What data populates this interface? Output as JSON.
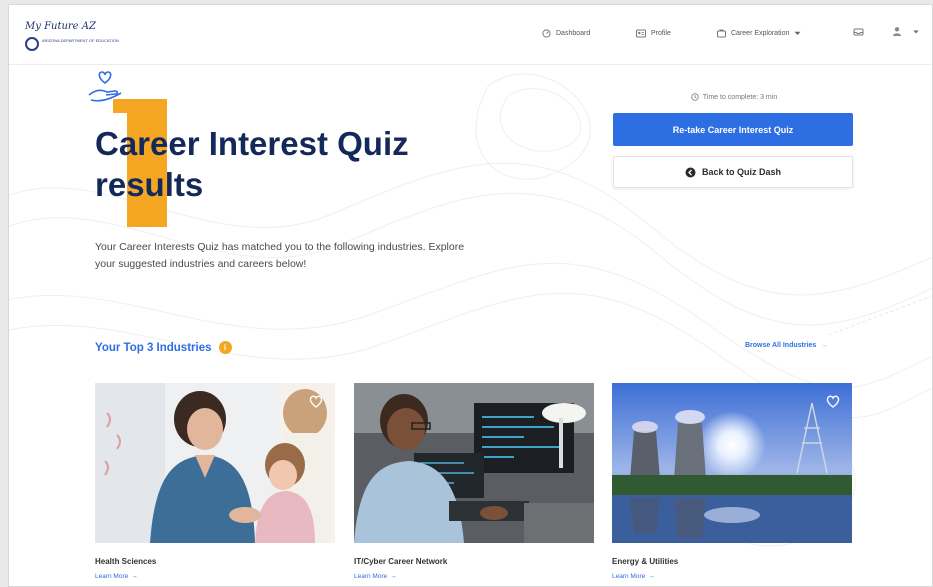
{
  "header": {
    "logo_text": "My Future AZ",
    "logo_subtext": "ARIZONA DEPARTMENT OF EDUCATION",
    "nav": {
      "dashboard": "Dashboard",
      "profile": "Profile",
      "career_exploration": "Career Exploration"
    }
  },
  "hero": {
    "title": "Career Interest Quiz results",
    "description": "Your Career Interests Quiz has matched you to the following industries. Explore your suggested industries and careers below!",
    "time_to_complete": "Time to complete: 3 min",
    "retake_button": "Re-take Career Interest Quiz",
    "back_button": "Back to Quiz Dash"
  },
  "section": {
    "title": "Your Top 3 Industries",
    "info_symbol": "i",
    "browse_link": "Browse All Industries",
    "browse_arrow": "→"
  },
  "cards": [
    {
      "title": "Health Sciences",
      "link": "Learn More",
      "arrow": "→"
    },
    {
      "title": "IT/Cyber Career Network",
      "link": "Learn More",
      "arrow": "→"
    },
    {
      "title": "Energy & Utilities",
      "link": "Learn More",
      "arrow": "→"
    }
  ],
  "colors": {
    "brand_navy": "#15285a",
    "primary_blue": "#2d6fe3",
    "accent_orange": "#f5a623"
  },
  "icons": [
    "dashboard-icon",
    "profile-icon",
    "career-icon",
    "chevron-down-icon",
    "inbox-icon",
    "user-icon",
    "clock-icon",
    "back-arrow-icon",
    "info-icon",
    "heart-icon",
    "hand-heart-icon"
  ]
}
